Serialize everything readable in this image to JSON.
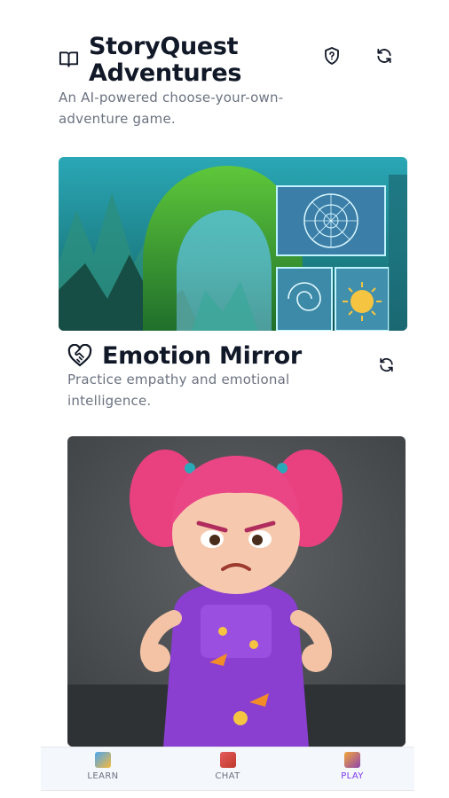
{
  "storyquest": {
    "title_line1": "StoryQuest",
    "title_line2": "Adventures",
    "description_line1": "An AI-powered choose-your-own-",
    "description_line2": "adventure game."
  },
  "emotion_mirror": {
    "title": "Emotion Mirror",
    "description_line1": "Practice empathy and emotional",
    "description_line2": "intelligence."
  },
  "bottom_nav": {
    "items": [
      {
        "label": "LEARN",
        "icon": "learn-icon"
      },
      {
        "label": "CHAT",
        "icon": "chat-icon"
      },
      {
        "label": "PLAY",
        "icon": "play-icon"
      }
    ],
    "active": "PLAY"
  },
  "colors": {
    "accent": "#7c3aed",
    "text": "#111827",
    "muted": "#6b7280"
  }
}
